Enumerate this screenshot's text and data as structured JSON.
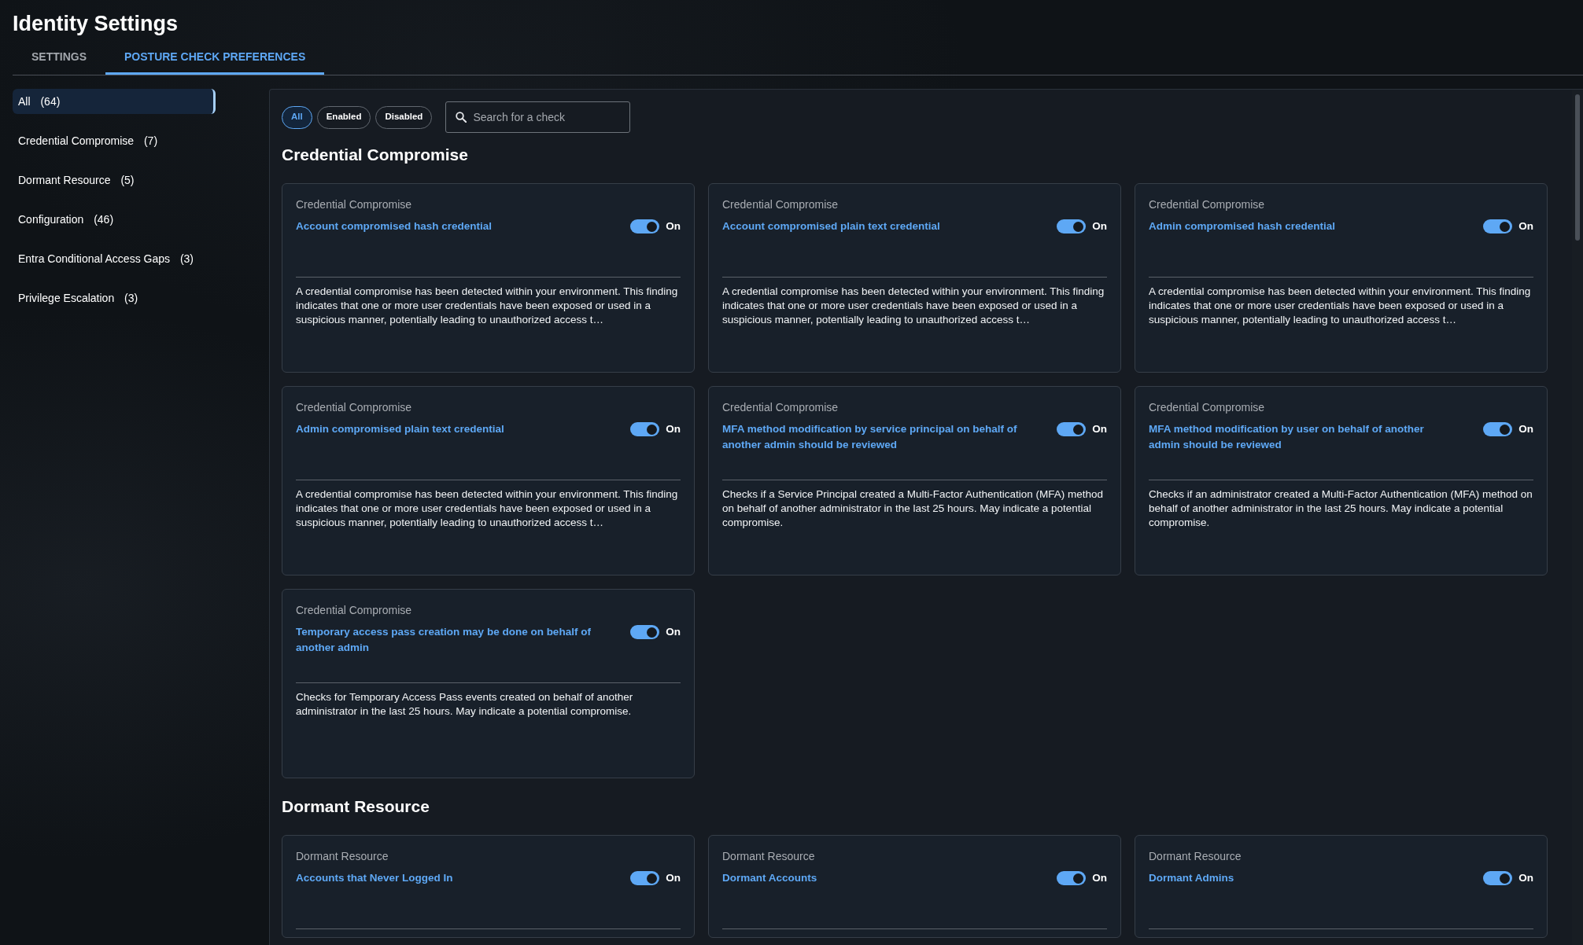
{
  "page": {
    "title": "Identity Settings"
  },
  "tabs": [
    {
      "label": "SETTINGS",
      "selected": false
    },
    {
      "label": "POSTURE CHECK PREFERENCES",
      "selected": true
    }
  ],
  "sidebar": {
    "items": [
      {
        "label": "All",
        "count": "(64)",
        "selected": true
      },
      {
        "label": "Credential Compromise",
        "count": "(7)",
        "selected": false
      },
      {
        "label": "Dormant Resource",
        "count": "(5)",
        "selected": false
      },
      {
        "label": "Configuration",
        "count": "(46)",
        "selected": false
      },
      {
        "label": "Entra Conditional Access Gaps",
        "count": "(3)",
        "selected": false
      },
      {
        "label": "Privilege Escalation",
        "count": "(3)",
        "selected": false
      }
    ]
  },
  "filters": [
    {
      "label": "All",
      "selected": true
    },
    {
      "label": "Enabled",
      "selected": false
    },
    {
      "label": "Disabled",
      "selected": false
    }
  ],
  "search": {
    "placeholder": "Search for a check"
  },
  "sections": [
    {
      "heading": "Credential Compromise",
      "checks": [
        {
          "category": "Credential Compromise",
          "title": "Account compromised hash credential",
          "on": true,
          "state_label": "On",
          "description": "A credential compromise has been detected within your environment. This finding indicates that one or more user credentials have been exposed or used in a suspicious manner, potentially leading to unauthorized access t…"
        },
        {
          "category": "Credential Compromise",
          "title": "Account compromised plain text credential",
          "on": true,
          "state_label": "On",
          "description": "A credential compromise has been detected within your environment. This finding indicates that one or more user credentials have been exposed or used in a suspicious manner, potentially leading to unauthorized access t…"
        },
        {
          "category": "Credential Compromise",
          "title": "Admin compromised hash credential",
          "on": true,
          "state_label": "On",
          "description": "A credential compromise has been detected within your environment. This finding indicates that one or more user credentials have been exposed or used in a suspicious manner, potentially leading to unauthorized access t…"
        },
        {
          "category": "Credential Compromise",
          "title": "Admin compromised plain text credential",
          "on": true,
          "state_label": "On",
          "description": "A credential compromise has been detected within your environment. This finding indicates that one or more user credentials have been exposed or used in a suspicious manner, potentially leading to unauthorized access t…"
        },
        {
          "category": "Credential Compromise",
          "title": "MFA method modification by service principal on behalf of another admin should be reviewed",
          "on": true,
          "state_label": "On",
          "description": "Checks if a Service Principal created a Multi-Factor Authentication (MFA) method on behalf of another administrator in the last 25 hours. May indicate a potential compromise."
        },
        {
          "category": "Credential Compromise",
          "title": "MFA method modification by user on behalf of another admin should be reviewed",
          "on": true,
          "state_label": "On",
          "description": "Checks if an administrator created a Multi-Factor Authentication (MFA) method on behalf of another administrator in the last 25 hours. May indicate a potential compromise."
        },
        {
          "category": "Credential Compromise",
          "title": "Temporary access pass creation may be done on behalf of another admin",
          "on": true,
          "state_label": "On",
          "description": "Checks for Temporary Access Pass events created on behalf of another administrator in the last 25 hours. May indicate a potential compromise."
        }
      ]
    },
    {
      "heading": "Dormant Resource",
      "checks": [
        {
          "category": "Dormant Resource",
          "title": "Accounts that Never Logged In",
          "on": true,
          "state_label": "On"
        },
        {
          "category": "Dormant Resource",
          "title": "Dormant Accounts",
          "on": true,
          "state_label": "On"
        },
        {
          "category": "Dormant Resource",
          "title": "Dormant Admins",
          "on": true,
          "state_label": "On"
        }
      ]
    }
  ]
}
